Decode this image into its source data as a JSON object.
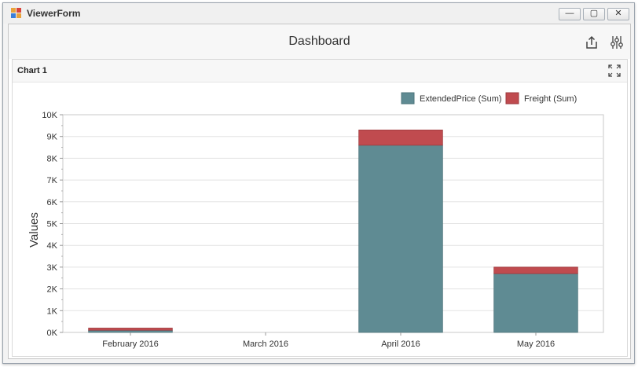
{
  "window": {
    "title": "ViewerForm",
    "minimize_label": "—",
    "maximize_label": "▢",
    "close_label": "✕"
  },
  "dashboard": {
    "title": "Dashboard",
    "icons": [
      "export-icon",
      "parameters-icon"
    ]
  },
  "panel": {
    "title": "Chart 1",
    "icon": "maximize-icon"
  },
  "colors": {
    "extended_price": "#5f8b93",
    "freight": "#c04b4f"
  },
  "chart_data": {
    "type": "bar",
    "stacked": true,
    "categories": [
      "February 2016",
      "March 2016",
      "April 2016",
      "May 2016"
    ],
    "series": [
      {
        "name": "ExtendedPrice (Sum)",
        "values": [
          100,
          0,
          8600,
          2700
        ]
      },
      {
        "name": "Freight (Sum)",
        "values": [
          100,
          0,
          700,
          300
        ]
      }
    ],
    "ylabel": "Values",
    "xlabel": "",
    "ylim": [
      0,
      10000
    ],
    "yticks": [
      "0K",
      "1K",
      "2K",
      "3K",
      "4K",
      "5K",
      "6K",
      "7K",
      "8K",
      "9K",
      "10K"
    ],
    "legend_position": "top-right",
    "grid": true
  }
}
